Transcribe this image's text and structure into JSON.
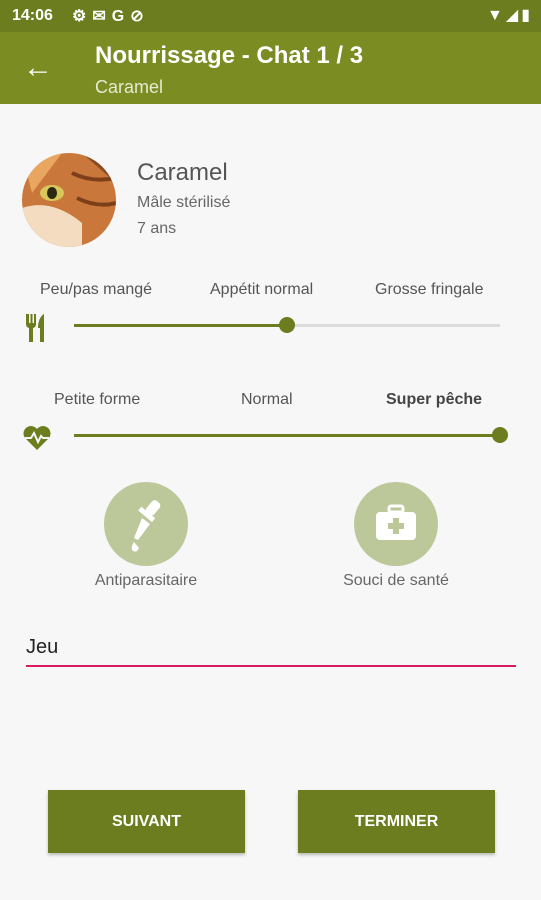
{
  "status_bar": {
    "time": "14:06",
    "left_icons": [
      "gear-icon",
      "mail-icon",
      "google-icon",
      "blocked-icon"
    ],
    "right_icons": [
      "wifi-icon",
      "signal-icon",
      "battery-icon"
    ]
  },
  "app_bar": {
    "title": "Nourrissage - Chat 1 / 3",
    "subtitle": "Caramel",
    "back_icon": "arrow-left-icon"
  },
  "cat": {
    "name": "Caramel",
    "description": "Mâle stérilisé",
    "age": "7 ans"
  },
  "appetite": {
    "icon": "fork-knife-icon",
    "labels": [
      "Peu/pas mangé",
      "Appétit normal",
      "Grosse fringale"
    ],
    "value": 0.5
  },
  "energy": {
    "icon": "heartbeat-icon",
    "labels": [
      "Petite forme",
      "Normal",
      "Super pêche"
    ],
    "selected_label": "Super pêche",
    "value": 1.0
  },
  "actions": {
    "antiparasite": {
      "label": "Antiparasitaire",
      "icon": "dropper-icon"
    },
    "health": {
      "label": "Souci de santé",
      "icon": "medical-kit-icon"
    }
  },
  "note_field": {
    "value": "Jeu"
  },
  "buttons": {
    "next": "SUIVANT",
    "finish": "TERMINER"
  },
  "colors": {
    "primary": "#7a8c22",
    "primary_dark": "#6b7d1f",
    "accent": "#d81b60",
    "circle": "#bcc89a"
  }
}
